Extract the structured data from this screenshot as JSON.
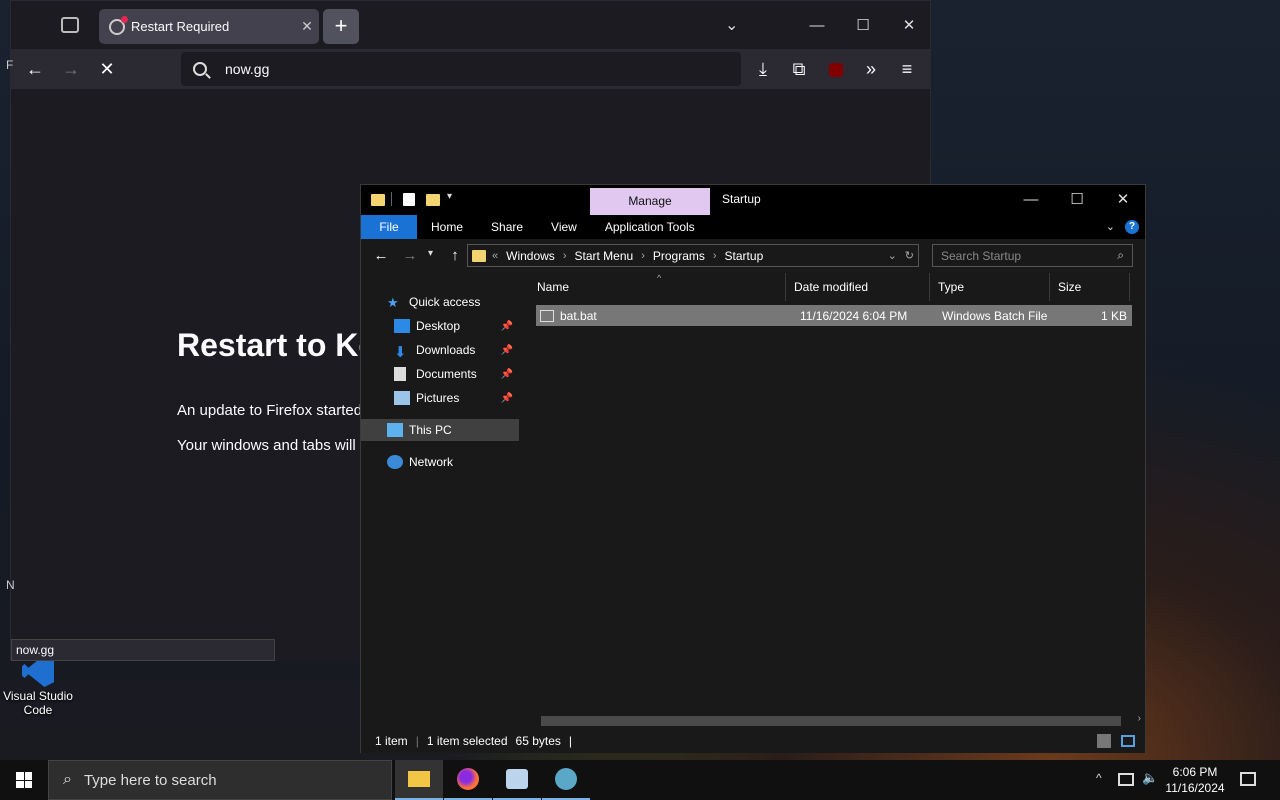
{
  "desktop": {
    "icon_label": "Visual Studio Code"
  },
  "firefox": {
    "tab_title": "Restart Required",
    "url": "now.gg",
    "status_url": "now.gg",
    "heading": "Restart to Ke",
    "para1": "An update to Firefox started",
    "para2": "Your windows and tabs will",
    "left_letter_top": "F",
    "left_letter_bottom": "N"
  },
  "explorer": {
    "manage_tab": "Manage",
    "window_title": "Startup",
    "ribbon_tabs": [
      "File",
      "Home",
      "Share",
      "View",
      "Application Tools"
    ],
    "breadcrumb": [
      "Windows",
      "Start Menu",
      "Programs",
      "Startup"
    ],
    "search_placeholder": "Search Startup",
    "nav": {
      "quick_access": "Quick access",
      "desktop": "Desktop",
      "downloads": "Downloads",
      "documents": "Documents",
      "pictures": "Pictures",
      "this_pc": "This PC",
      "network": "Network"
    },
    "columns": [
      "Name",
      "Date modified",
      "Type",
      "Size"
    ],
    "files": [
      {
        "name": "bat.bat",
        "date": "11/16/2024 6:04 PM",
        "type": "Windows Batch File",
        "size": "1 KB"
      }
    ],
    "status": {
      "items": "1 item",
      "selected": "1 item selected",
      "size": "65 bytes"
    }
  },
  "taskbar": {
    "search_placeholder": "Type here to search",
    "time": "6:06 PM",
    "date": "11/16/2024"
  },
  "colors": {
    "manage_accent": "#e0c8f0",
    "file_tab": "#1a73d4",
    "firefox_bg": "#1c1b22"
  }
}
